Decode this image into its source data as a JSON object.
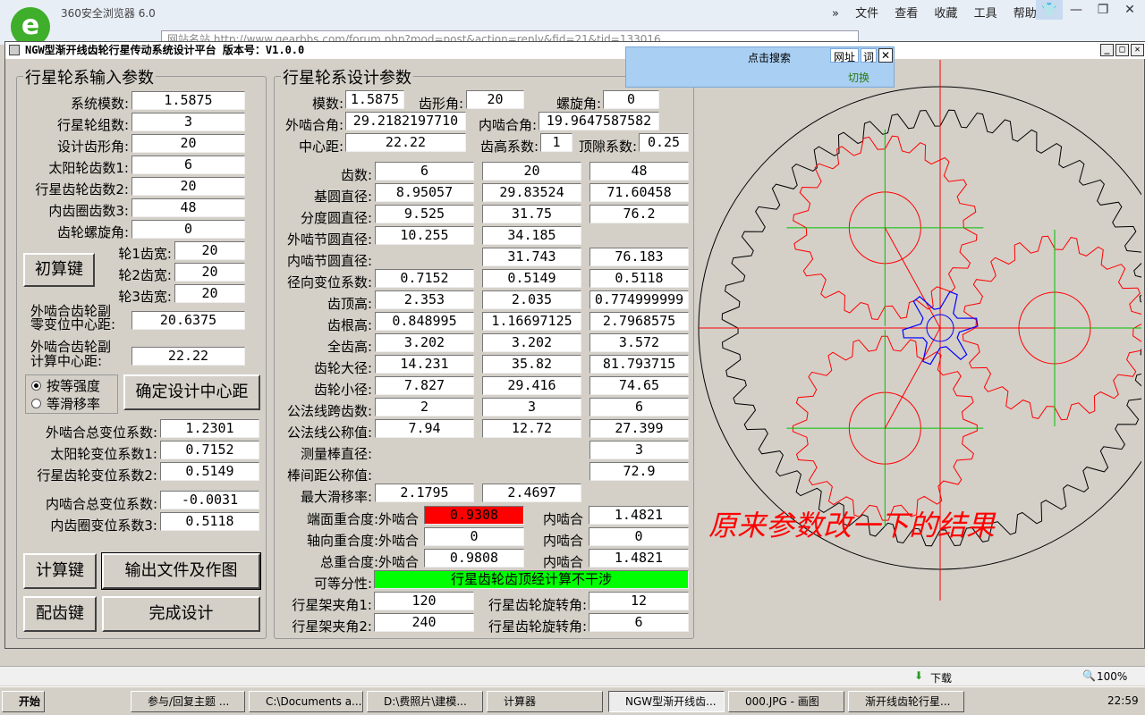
{
  "browser": {
    "title": "360安全浏览器 6.0",
    "menu": [
      "文件",
      "查看",
      "收藏",
      "工具",
      "帮助"
    ],
    "url": "http://www.gearbbs.com/forum.php?mod=post&action=reply&fid=21&tid=133016",
    "url_prefix": "网站名站"
  },
  "app": {
    "title": "NGW型渐开线齿轮行星传动系统设计平台   版本号：V1.0.0",
    "input_group": {
      "title": "行星轮系输入参数",
      "fields": [
        {
          "label": "系统模数:",
          "value": "1.5875"
        },
        {
          "label": "行星轮组数:",
          "value": "3"
        },
        {
          "label": "设计齿形角:",
          "value": "20"
        },
        {
          "label": "太阳轮齿数1:",
          "value": "6"
        },
        {
          "label": "行星齿轮齿数2:",
          "value": "20"
        },
        {
          "label": "内齿圈齿数3:",
          "value": "48"
        },
        {
          "label": "齿轮螺旋角:",
          "value": "0"
        }
      ],
      "widths": [
        {
          "label": "轮1齿宽:",
          "value": "20"
        },
        {
          "label": "轮2齿宽:",
          "value": "20"
        },
        {
          "label": "轮3齿宽:",
          "value": "20"
        }
      ],
      "init_button": "初算键",
      "zero_center_label1": "外啮合齿轮副",
      "zero_center_label2": "零变位中心距:",
      "zero_center_value": "20.6375",
      "calc_center_label1": "外啮合齿轮副",
      "calc_center_label2": "计算中心距:",
      "calc_center_value": "22.22",
      "radio1": "按等强度",
      "radio2": "等滑移率",
      "confirm_button": "确定设计中心距",
      "ext_total_label": "外啮合总变位系数:",
      "ext_total_value": "1.2301",
      "sun_shift_label": "太阳轮变位系数1:",
      "sun_shift_value": "0.7152",
      "planet_shift_label": "行星齿轮变位系数2:",
      "planet_shift_value": "0.5149",
      "int_total_label": "内啮合总变位系数:",
      "int_total_value": "-0.0031",
      "ring_shift_label": "内齿圈变位系数3:",
      "ring_shift_value": "0.5118",
      "calc_button": "计算键",
      "output_button": "输出文件及作图",
      "match_button": "配齿键",
      "finish_button": "完成设计"
    },
    "design_group": {
      "title": "行星轮系设计参数",
      "module_label": "模数:",
      "module_value": "1.5875",
      "pressure_label": "齿形角:",
      "pressure_value": "20",
      "helix_label": "螺旋角:",
      "helix_value": "0",
      "ext_angle_label": "外啮合角:",
      "ext_angle_value": "29.2182197710",
      "int_angle_label": "内啮合角:",
      "int_angle_value": "19.9647587582",
      "center_label": "中心距:",
      "center_value": "22.22",
      "addendum_coef_label": "齿高系数:",
      "addendum_coef_value": "1",
      "clearance_label": "顶隙系数:",
      "clearance_value": "0.25",
      "rows": [
        {
          "label": "齿数:",
          "v": [
            "6",
            "20",
            "48"
          ]
        },
        {
          "label": "基圆直径:",
          "v": [
            "8.95057",
            "29.83524",
            "71.60458"
          ]
        },
        {
          "label": "分度圆直径:",
          "v": [
            "9.525",
            "31.75",
            "76.2"
          ]
        },
        {
          "label": "外啮节圆直径:",
          "v": [
            "10.255",
            "34.185",
            ""
          ]
        },
        {
          "label": "内啮节圆直径:",
          "v": [
            "",
            "31.743",
            "76.183"
          ]
        },
        {
          "label": "径向变位系数:",
          "v": [
            "0.7152",
            "0.5149",
            "0.5118"
          ]
        },
        {
          "label": "齿顶高:",
          "v": [
            "2.353",
            "2.035",
            "0.774999999"
          ]
        },
        {
          "label": "齿根高:",
          "v": [
            "0.848995",
            "1.16697125",
            "2.7968575"
          ]
        },
        {
          "label": "全齿高:",
          "v": [
            "3.202",
            "3.202",
            "3.572"
          ]
        },
        {
          "label": "齿轮大径:",
          "v": [
            "14.231",
            "35.82",
            "81.793715"
          ]
        },
        {
          "label": "齿轮小径:",
          "v": [
            "7.827",
            "29.416",
            "74.65"
          ]
        },
        {
          "label": "公法线跨齿数:",
          "v": [
            "2",
            "3",
            "6"
          ]
        },
        {
          "label": "公法线公称值:",
          "v": [
            "7.94",
            "12.72",
            "27.399"
          ]
        },
        {
          "label": "测量棒直径:",
          "v": [
            "",
            "",
            "3"
          ]
        },
        {
          "label": "棒间距公称值:",
          "v": [
            "",
            "",
            "72.9"
          ]
        },
        {
          "label": "最大滑移率:",
          "v": [
            "2.1795",
            "2.4697",
            ""
          ]
        }
      ],
      "face_overlap_label": "端面重合度:外啮合",
      "face_overlap_ext": "0.9308",
      "face_overlap_int_label": "内啮合",
      "face_overlap_int": "1.4821",
      "axial_overlap_label": "轴向重合度:外啮合",
      "axial_overlap_ext": "0",
      "axial_overlap_int_label": "内啮合",
      "axial_overlap_int": "0",
      "total_overlap_label": "总重合度:外啮合",
      "total_overlap_ext": "0.9808",
      "total_overlap_int_label": "内啮合",
      "total_overlap_int": "1.4821",
      "assembly_label": "可等分性:",
      "assembly_status": "行星齿轮齿顶经计算不干涉",
      "carrier1_label": "行星架夹角1:",
      "carrier1_value": "120",
      "rot1_label": "行星齿轮旋转角:",
      "rot1_value": "12",
      "carrier2_label": "行星架夹角2:",
      "carrier2_value": "240",
      "rot2_label": "行星齿轮旋转角:",
      "rot2_value": "6"
    },
    "annotation": "原来参数改一下的结果"
  },
  "popup": {
    "search": "点击搜索",
    "tab1": "网址",
    "tab2": "词",
    "switch": "切换"
  },
  "statusbar": {
    "download": "下载",
    "zoom": "100%"
  },
  "taskbar": {
    "start": "开始",
    "tasks": [
      "参与/回复主题 ...",
      "C:\\Documents a...",
      "D:\\费照片\\建模...",
      "计算器",
      "NGW型渐开线齿...",
      "000.JPG - 画图",
      "渐开线齿轮行星..."
    ],
    "clock": "22:59"
  },
  "colors": {
    "warning": "#ff0000",
    "ok": "#00ff00",
    "gear_ring": "#000000",
    "gear_planet": "#ff0000",
    "gear_sun": "#0000ff",
    "axis_red": "#ff0000",
    "axis_green": "#00c000"
  }
}
